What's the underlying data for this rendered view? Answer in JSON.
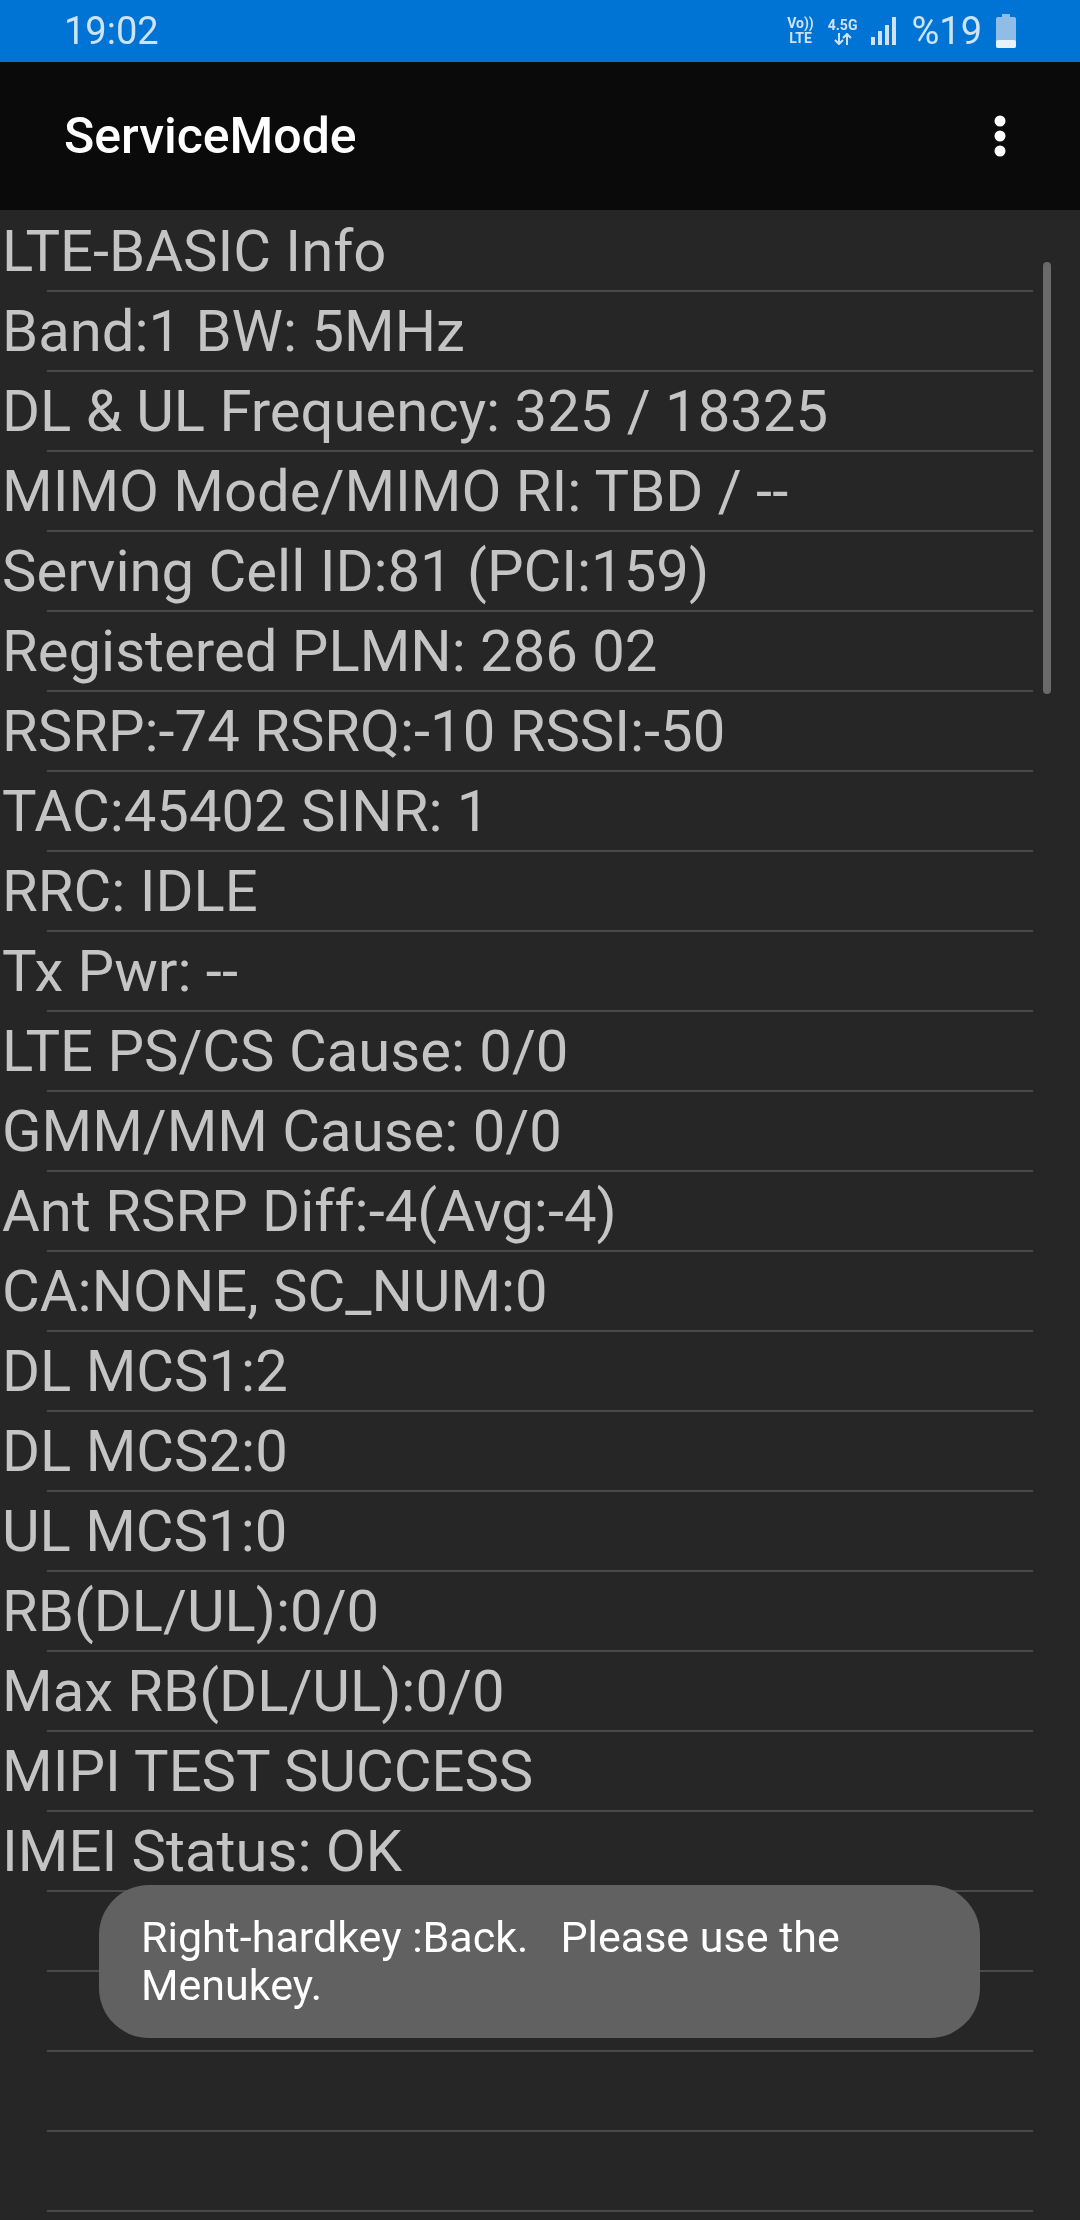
{
  "status_bar": {
    "time": "19:02",
    "volte_top": "Vo))",
    "volte_bottom": "LTE",
    "network": "4.5G",
    "battery_text": "%19"
  },
  "app_bar": {
    "title": "ServiceMode"
  },
  "rows": [
    {
      "text": "LTE-BASIC Info"
    },
    {
      "text": "Band:1 BW: 5MHz"
    },
    {
      "text": "DL & UL Frequency: 325 / 18325"
    },
    {
      "text": "MIMO Mode/MIMO RI: TBD / --"
    },
    {
      "text": "Serving Cell ID:81 (PCI:159)"
    },
    {
      "text": "Registered PLMN: 286 02"
    },
    {
      "text": "RSRP:-74 RSRQ:-10 RSSI:-50"
    },
    {
      "text": "TAC:45402 SINR: 1"
    },
    {
      "text": "RRC: IDLE"
    },
    {
      "text": "Tx Pwr: --"
    },
    {
      "text": "LTE PS/CS Cause: 0/0"
    },
    {
      "text": "GMM/MM Cause: 0/0"
    },
    {
      "text": "Ant RSRP Diff:-4(Avg:-4)"
    },
    {
      "text": "CA:NONE, SC_NUM:0"
    },
    {
      "text": "DL MCS1:2"
    },
    {
      "text": "DL MCS2:0"
    },
    {
      "text": "UL MCS1:0"
    },
    {
      "text": "RB(DL/UL):0/0"
    },
    {
      "text": "Max RB(DL/UL):0/0"
    },
    {
      "text": "MIPI TEST SUCCESS"
    },
    {
      "text": "IMEI Status: OK"
    }
  ],
  "toast": {
    "text": "Right-hardkey :Back.   Please use the Menukey."
  }
}
